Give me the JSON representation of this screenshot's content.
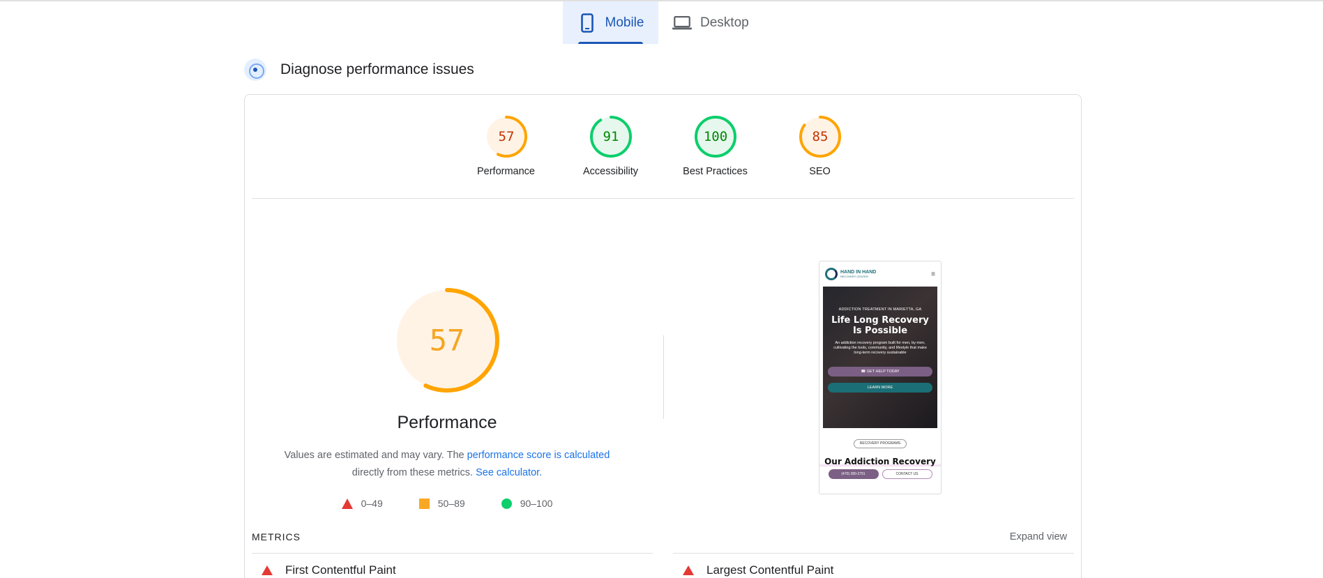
{
  "tabs": [
    {
      "label": "Mobile",
      "icon": "phone-icon",
      "active": true
    },
    {
      "label": "Desktop",
      "icon": "laptop-icon",
      "active": false
    }
  ],
  "section": {
    "title": "Diagnose performance issues",
    "icon": "diagnose-icon"
  },
  "categories": [
    {
      "label": "Performance",
      "score": "57",
      "value": 0.57,
      "status": "average"
    },
    {
      "label": "Accessibility",
      "score": "91",
      "value": 0.91,
      "status": "pass"
    },
    {
      "label": "Best Practices",
      "score": "100",
      "value": 1.0,
      "status": "pass"
    },
    {
      "label": "SEO",
      "score": "85",
      "value": 0.85,
      "status": "average"
    }
  ],
  "colors": {
    "average_stroke": "#ffa400",
    "average_fill": "#fff3e6",
    "average_text": "#c33300",
    "pass_stroke": "#0cce6b",
    "pass_fill": "#e6f8ee",
    "pass_text": "#008800",
    "big_text": "#f5a623",
    "fail": "#ff4e42",
    "accent": "#1a73e8"
  },
  "performance": {
    "score": "57",
    "value": 0.57,
    "label": "Performance",
    "desc_prefix": "Values are estimated and may vary. The ",
    "desc_link": "performance score is calculated",
    "desc_mid": "directly from these metrics.",
    "desc_calc": "See calculator.",
    "legend": [
      {
        "shape": "triangle",
        "range": "0–49"
      },
      {
        "shape": "square",
        "range": "50–89"
      },
      {
        "shape": "circle",
        "range": "90–100"
      }
    ]
  },
  "preview": {
    "logo_text": "HAND IN HAND",
    "logo_sub": "RECOVERY CENTER",
    "eyebrow": "ADDICTION TREATMENT IN MARIETTA, GA",
    "headline": "Life Long Recovery Is Possible",
    "body": "An addiction recovery program built for men, by men, cultivating the tools, community, and lifestyle that make long-term recovery sustainable",
    "btn_primary": "GET HELP TODAY",
    "btn_secondary": "LEARN MORE",
    "pill": "RECOVERY PROGRAMS",
    "section_title": "Our Addiction Recovery",
    "phone_btn": "(470) 280-2791",
    "contact_btn": "CONTACT US"
  },
  "metrics": {
    "title": "METRICS",
    "expand": "Expand view",
    "items": [
      {
        "label": "First Contentful Paint",
        "status": "fail"
      },
      {
        "label": "Largest Contentful Paint",
        "status": "fail"
      }
    ]
  }
}
